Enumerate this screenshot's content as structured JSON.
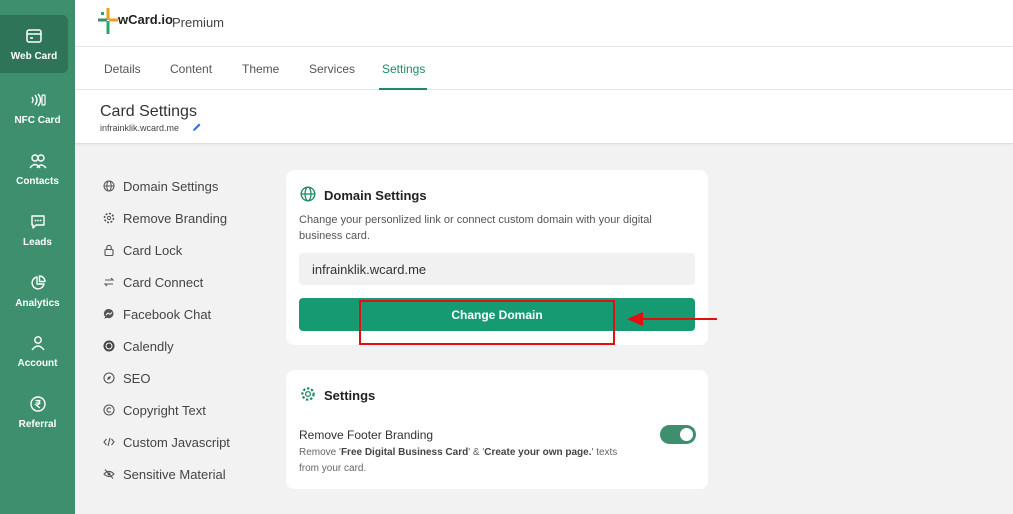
{
  "sidebar": {
    "items": [
      {
        "label": "Web Card",
        "icon": "card-icon",
        "active": true
      },
      {
        "label": "NFC Card",
        "icon": "nfc-icon"
      },
      {
        "label": "Contacts",
        "icon": "contacts-icon"
      },
      {
        "label": "Leads",
        "icon": "chat-icon"
      },
      {
        "label": "Analytics",
        "icon": "pie-chart-icon"
      },
      {
        "label": "Account",
        "icon": "user-icon"
      },
      {
        "label": "Referral",
        "icon": "rupee-icon"
      }
    ]
  },
  "header": {
    "brand": "wCard.io",
    "plan": "Premium"
  },
  "tabs": [
    {
      "label": "Details"
    },
    {
      "label": "Content"
    },
    {
      "label": "Theme"
    },
    {
      "label": "Services"
    },
    {
      "label": "Settings",
      "active": true
    }
  ],
  "page": {
    "title": "Card Settings",
    "subtitle": "infrainklik.wcard.me"
  },
  "settings_menu": [
    {
      "label": "Domain Settings",
      "icon": "globe-icon"
    },
    {
      "label": "Remove Branding",
      "icon": "gear-icon"
    },
    {
      "label": "Card Lock",
      "icon": "lock-icon"
    },
    {
      "label": "Card Connect",
      "icon": "swap-icon"
    },
    {
      "label": "Facebook Chat",
      "icon": "messenger-icon"
    },
    {
      "label": "Calendly",
      "icon": "calendly-icon"
    },
    {
      "label": "SEO",
      "icon": "compass-icon"
    },
    {
      "label": "Copyright Text",
      "icon": "copyright-icon"
    },
    {
      "label": "Custom Javascript",
      "icon": "code-icon"
    },
    {
      "label": "Sensitive Material",
      "icon": "eye-off-icon"
    }
  ],
  "domain_card": {
    "title": "Domain Settings",
    "description": "Change your personlized link or connect custom domain with your digital business card.",
    "domain_value": "infrainklik.wcard.me",
    "button_label": "Change Domain"
  },
  "settings_card": {
    "title": "Settings",
    "option_label": "Remove Footer Branding",
    "desc_prefix": "Remove '",
    "desc_bold1": "Free Digital Business Card",
    "desc_mid": "' & '",
    "desc_bold2": "Create your own page.",
    "desc_suffix": "' texts from your card.",
    "toggle_on": true
  },
  "colors": {
    "sidebar": "#3d8f6e",
    "accent": "#169a72",
    "annotation": "#e01010"
  }
}
